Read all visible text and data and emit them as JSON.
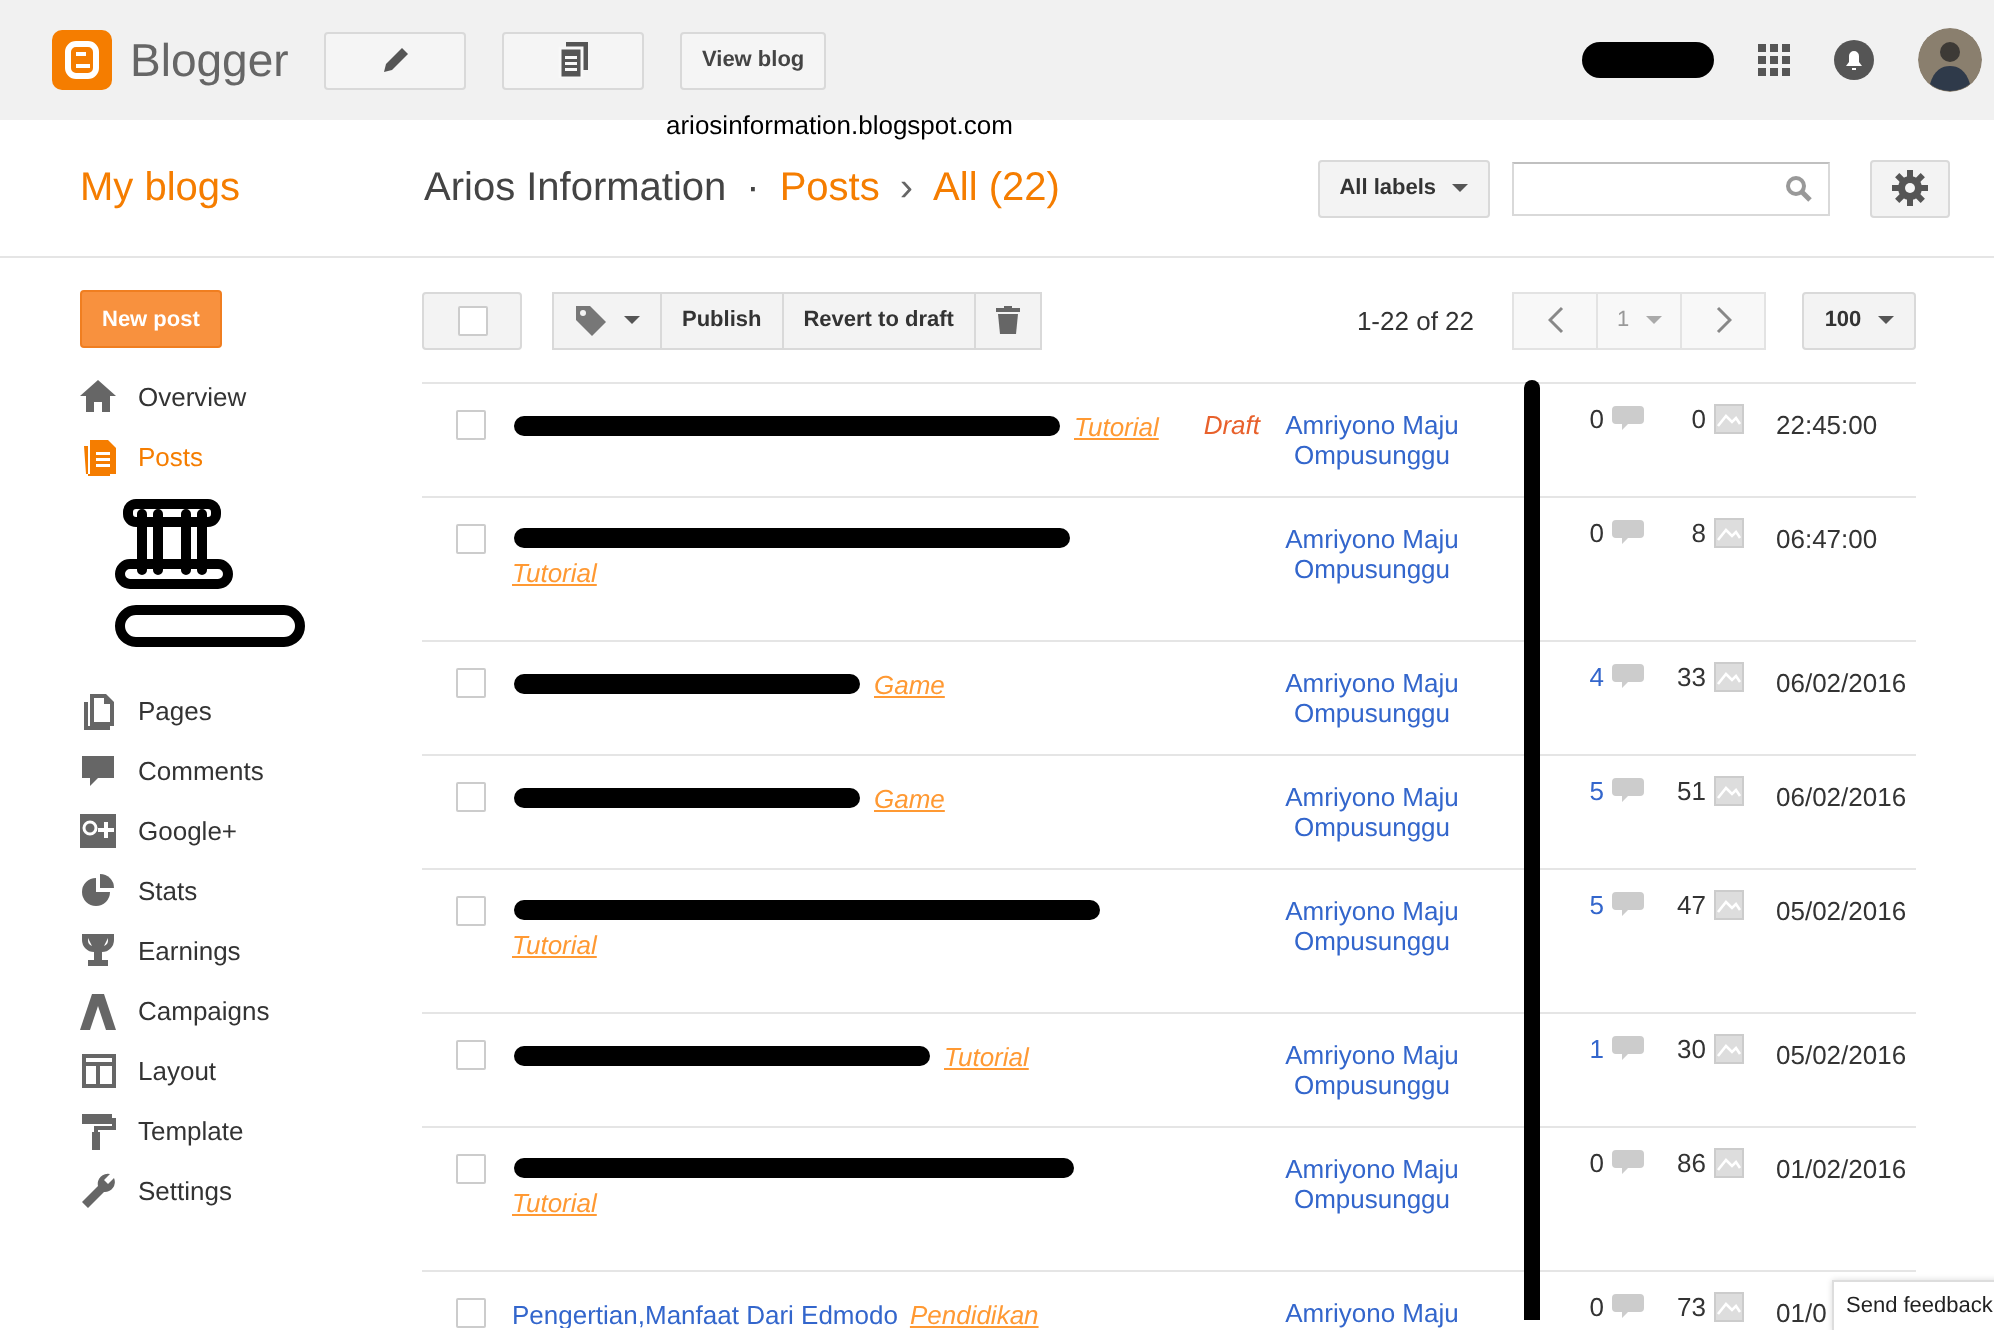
{
  "header": {
    "logo_text": "Blogger",
    "view_blog": "View blog",
    "account_redacted": true,
    "blog_address": "ariosinformation.blogspot.com"
  },
  "title_bar": {
    "my_blogs": "My blogs",
    "blog_name": "Arios Information",
    "separator": "·",
    "section": "Posts",
    "chevron": "›",
    "filter": "All (22)",
    "labels_button": "All labels"
  },
  "sidebar": {
    "new_post": "New post",
    "items": [
      {
        "label": "Overview",
        "selected": false
      },
      {
        "label": "Posts",
        "selected": true,
        "children_redacted": true
      },
      {
        "label": "Pages",
        "selected": false
      },
      {
        "label": "Comments",
        "selected": false
      },
      {
        "label": "Google+",
        "selected": false
      },
      {
        "label": "Stats",
        "selected": false
      },
      {
        "label": "Earnings",
        "selected": false
      },
      {
        "label": "Campaigns",
        "selected": false
      },
      {
        "label": "Layout",
        "selected": false
      },
      {
        "label": "Template",
        "selected": false
      },
      {
        "label": "Settings",
        "selected": false
      }
    ]
  },
  "toolbar": {
    "select_all_checked": false,
    "publish": "Publish",
    "revert": "Revert to draft",
    "range": "1-22 of 22",
    "page": "1",
    "per_page": "100"
  },
  "views_redacted": true,
  "posts": [
    {
      "checked": false,
      "title_redacted": true,
      "label": "Tutorial",
      "label_below": false,
      "status": "Draft",
      "author": "Amriyono Maju Ompusunggu",
      "comments": "0",
      "comments_link": false,
      "images": "0",
      "date": "22:45:00"
    },
    {
      "checked": false,
      "title_redacted": true,
      "label": "Tutorial",
      "label_below": true,
      "author": "Amriyono Maju Ompusunggu",
      "comments": "0",
      "comments_link": false,
      "images": "8",
      "date": "06:47:00"
    },
    {
      "checked": false,
      "title_redacted": true,
      "label": "Game",
      "label_below": false,
      "author": "Amriyono Maju Ompusunggu",
      "comments": "4",
      "comments_link": true,
      "images": "33",
      "date": "06/02/2016"
    },
    {
      "checked": false,
      "title_redacted": true,
      "label": "Game",
      "label_below": false,
      "author": "Amriyono Maju Ompusunggu",
      "comments": "5",
      "comments_link": true,
      "images": "51",
      "date": "06/02/2016"
    },
    {
      "checked": false,
      "title_redacted": true,
      "label": "Tutorial",
      "label_below": true,
      "author": "Amriyono Maju Ompusunggu",
      "comments": "5",
      "comments_link": true,
      "images": "47",
      "date": "05/02/2016"
    },
    {
      "checked": false,
      "title_redacted": true,
      "label": "Tutorial",
      "label_below": false,
      "author": "Amriyono Maju Ompusunggu",
      "comments": "1",
      "comments_link": true,
      "images": "30",
      "date": "05/02/2016"
    },
    {
      "checked": false,
      "title_redacted": true,
      "label": "Tutorial",
      "label_below": true,
      "author": "Amriyono Maju Ompusunggu",
      "comments": "0",
      "comments_link": false,
      "images": "86",
      "date": "01/02/2016"
    },
    {
      "checked": false,
      "title_redacted": false,
      "title": "Pengertian,Manfaat Dari Edmodo",
      "label": "Pendidikan",
      "label_below": false,
      "author": "Amriyono Maju",
      "comments": "0",
      "comments_link": false,
      "images": "73",
      "date": "01/0"
    }
  ],
  "feedback": "Send feedback"
}
